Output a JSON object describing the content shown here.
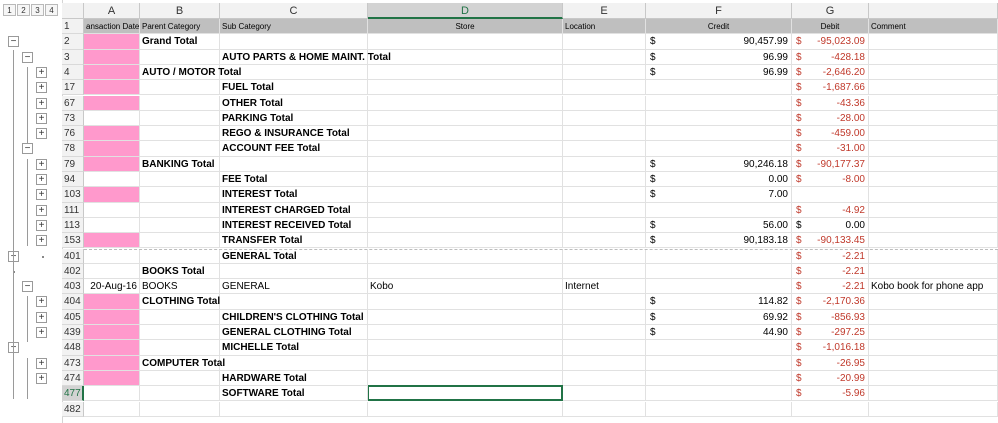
{
  "outline_levels": [
    "1",
    "2",
    "3",
    "4"
  ],
  "columns": [
    {
      "letter": "A"
    },
    {
      "letter": "B"
    },
    {
      "letter": "C"
    },
    {
      "letter": "D"
    },
    {
      "letter": "E"
    },
    {
      "letter": "F"
    },
    {
      "letter": "G"
    }
  ],
  "headers": [
    "ansaction Date",
    "Parent Category",
    "Sub Category",
    "Store",
    "Location",
    "Credit",
    "Debit",
    "Comment"
  ],
  "rows": [
    {
      "num": "1",
      "type": "header"
    },
    {
      "num": "2",
      "pink": true,
      "b": "Grand Total",
      "c": "",
      "credit": "90,457.99",
      "debit": "-95,023.09"
    },
    {
      "num": "3",
      "pink": true,
      "b": "",
      "c": "AUTO PARTS & HOME MAINT. Total",
      "credit": "96.99",
      "debit": "-428.18"
    },
    {
      "num": "4",
      "pink": true,
      "b": "AUTO / MOTOR Total",
      "c": "",
      "credit": "96.99",
      "debit": "-2,646.20"
    },
    {
      "num": "17",
      "pink": true,
      "b": "",
      "c": "FUEL Total",
      "credit": "",
      "debit": "-1,687.66"
    },
    {
      "num": "67",
      "pink": true,
      "b": "",
      "c": "OTHER Total",
      "credit": "",
      "debit": "-43.36"
    },
    {
      "num": "73",
      "pink": false,
      "b": "",
      "c": "PARKING Total",
      "credit": "",
      "debit": "-28.00"
    },
    {
      "num": "76",
      "pink": true,
      "b": "",
      "c": "REGO & INSURANCE Total",
      "credit": "",
      "debit": "-459.00"
    },
    {
      "num": "78",
      "pink": true,
      "b": "",
      "c": "ACCOUNT FEE Total",
      "credit": "",
      "debit": "-31.00"
    },
    {
      "num": "79",
      "pink": true,
      "b": "BANKING Total",
      "c": "",
      "credit": "90,246.18",
      "debit": "-90,177.37"
    },
    {
      "num": "94",
      "pink": false,
      "b": "",
      "c": "FEE Total",
      "credit": "0.00",
      "debit": "-8.00"
    },
    {
      "num": "103",
      "pink": true,
      "b": "",
      "c": "INTEREST Total",
      "credit": "7.00",
      "debit": ""
    },
    {
      "num": "111",
      "pink": false,
      "b": "",
      "c": "INTEREST CHARGED Total",
      "credit": "",
      "debit": "-4.92"
    },
    {
      "num": "113",
      "pink": false,
      "b": "",
      "c": "INTEREST RECEIVED Total",
      "credit": "56.00",
      "debit": "0.00"
    },
    {
      "num": "153",
      "pink": true,
      "b": "",
      "c": "TRANSFER Total",
      "credit": "90,183.18",
      "debit": "-90,133.45"
    },
    {
      "num": "401",
      "pink": false,
      "b": "",
      "c": "GENERAL Total",
      "credit": "",
      "debit": "-2.21"
    },
    {
      "num": "402",
      "pink": false,
      "b": "BOOKS Total",
      "c": "",
      "credit": "",
      "debit": "-2.21"
    },
    {
      "num": "403",
      "pink": false,
      "plain": true,
      "a": "20-Aug-16",
      "b": "BOOKS",
      "c": "GENERAL",
      "d": "Kobo",
      "e": "Internet",
      "credit": "",
      "debit": "-2.21",
      "comment": "Kobo book for phone app"
    },
    {
      "num": "404",
      "pink": true,
      "b": "CLOTHING Total",
      "c": "",
      "credit": "114.82",
      "debit": "-2,170.36"
    },
    {
      "num": "405",
      "pink": true,
      "b": "",
      "c": "CHILDREN'S CLOTHING Total",
      "credit": "69.92",
      "debit": "-856.93"
    },
    {
      "num": "439",
      "pink": true,
      "b": "",
      "c": "GENERAL CLOTHING Total",
      "credit": "44.90",
      "debit": "-297.25"
    },
    {
      "num": "448",
      "pink": true,
      "b": "",
      "c": "MICHELLE Total",
      "credit": "",
      "debit": "-1,016.18"
    },
    {
      "num": "473",
      "pink": true,
      "b": "COMPUTER Total",
      "c": "",
      "credit": "",
      "debit": "-26.95"
    },
    {
      "num": "474",
      "pink": true,
      "b": "",
      "c": "HARDWARE Total",
      "credit": "",
      "debit": "-20.99"
    },
    {
      "num": "477",
      "pink": false,
      "b": "",
      "c": "SOFTWARE Total",
      "credit": "",
      "debit": "-5.96",
      "selected": true
    },
    {
      "num": "482",
      "type": "empty"
    }
  ],
  "currency_symbol": "$",
  "selected_cell": "D477",
  "colors": {
    "pink": "#ff99cc",
    "header_fill": "#bfbfbf",
    "negative": "#c0392b",
    "selection": "#217346"
  }
}
